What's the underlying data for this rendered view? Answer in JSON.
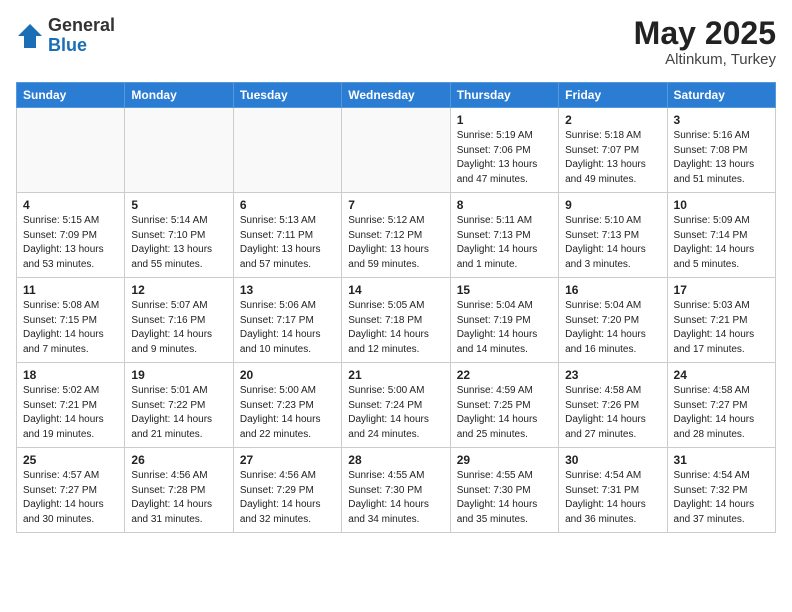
{
  "header": {
    "logo_general": "General",
    "logo_blue": "Blue",
    "title": "May 2025",
    "subtitle": "Altinkum, Turkey"
  },
  "weekdays": [
    "Sunday",
    "Monday",
    "Tuesday",
    "Wednesday",
    "Thursday",
    "Friday",
    "Saturday"
  ],
  "weeks": [
    [
      {
        "day": "",
        "info": ""
      },
      {
        "day": "",
        "info": ""
      },
      {
        "day": "",
        "info": ""
      },
      {
        "day": "",
        "info": ""
      },
      {
        "day": "1",
        "info": "Sunrise: 5:19 AM\nSunset: 7:06 PM\nDaylight: 13 hours\nand 47 minutes."
      },
      {
        "day": "2",
        "info": "Sunrise: 5:18 AM\nSunset: 7:07 PM\nDaylight: 13 hours\nand 49 minutes."
      },
      {
        "day": "3",
        "info": "Sunrise: 5:16 AM\nSunset: 7:08 PM\nDaylight: 13 hours\nand 51 minutes."
      }
    ],
    [
      {
        "day": "4",
        "info": "Sunrise: 5:15 AM\nSunset: 7:09 PM\nDaylight: 13 hours\nand 53 minutes."
      },
      {
        "day": "5",
        "info": "Sunrise: 5:14 AM\nSunset: 7:10 PM\nDaylight: 13 hours\nand 55 minutes."
      },
      {
        "day": "6",
        "info": "Sunrise: 5:13 AM\nSunset: 7:11 PM\nDaylight: 13 hours\nand 57 minutes."
      },
      {
        "day": "7",
        "info": "Sunrise: 5:12 AM\nSunset: 7:12 PM\nDaylight: 13 hours\nand 59 minutes."
      },
      {
        "day": "8",
        "info": "Sunrise: 5:11 AM\nSunset: 7:13 PM\nDaylight: 14 hours\nand 1 minute."
      },
      {
        "day": "9",
        "info": "Sunrise: 5:10 AM\nSunset: 7:13 PM\nDaylight: 14 hours\nand 3 minutes."
      },
      {
        "day": "10",
        "info": "Sunrise: 5:09 AM\nSunset: 7:14 PM\nDaylight: 14 hours\nand 5 minutes."
      }
    ],
    [
      {
        "day": "11",
        "info": "Sunrise: 5:08 AM\nSunset: 7:15 PM\nDaylight: 14 hours\nand 7 minutes."
      },
      {
        "day": "12",
        "info": "Sunrise: 5:07 AM\nSunset: 7:16 PM\nDaylight: 14 hours\nand 9 minutes."
      },
      {
        "day": "13",
        "info": "Sunrise: 5:06 AM\nSunset: 7:17 PM\nDaylight: 14 hours\nand 10 minutes."
      },
      {
        "day": "14",
        "info": "Sunrise: 5:05 AM\nSunset: 7:18 PM\nDaylight: 14 hours\nand 12 minutes."
      },
      {
        "day": "15",
        "info": "Sunrise: 5:04 AM\nSunset: 7:19 PM\nDaylight: 14 hours\nand 14 minutes."
      },
      {
        "day": "16",
        "info": "Sunrise: 5:04 AM\nSunset: 7:20 PM\nDaylight: 14 hours\nand 16 minutes."
      },
      {
        "day": "17",
        "info": "Sunrise: 5:03 AM\nSunset: 7:21 PM\nDaylight: 14 hours\nand 17 minutes."
      }
    ],
    [
      {
        "day": "18",
        "info": "Sunrise: 5:02 AM\nSunset: 7:21 PM\nDaylight: 14 hours\nand 19 minutes."
      },
      {
        "day": "19",
        "info": "Sunrise: 5:01 AM\nSunset: 7:22 PM\nDaylight: 14 hours\nand 21 minutes."
      },
      {
        "day": "20",
        "info": "Sunrise: 5:00 AM\nSunset: 7:23 PM\nDaylight: 14 hours\nand 22 minutes."
      },
      {
        "day": "21",
        "info": "Sunrise: 5:00 AM\nSunset: 7:24 PM\nDaylight: 14 hours\nand 24 minutes."
      },
      {
        "day": "22",
        "info": "Sunrise: 4:59 AM\nSunset: 7:25 PM\nDaylight: 14 hours\nand 25 minutes."
      },
      {
        "day": "23",
        "info": "Sunrise: 4:58 AM\nSunset: 7:26 PM\nDaylight: 14 hours\nand 27 minutes."
      },
      {
        "day": "24",
        "info": "Sunrise: 4:58 AM\nSunset: 7:27 PM\nDaylight: 14 hours\nand 28 minutes."
      }
    ],
    [
      {
        "day": "25",
        "info": "Sunrise: 4:57 AM\nSunset: 7:27 PM\nDaylight: 14 hours\nand 30 minutes."
      },
      {
        "day": "26",
        "info": "Sunrise: 4:56 AM\nSunset: 7:28 PM\nDaylight: 14 hours\nand 31 minutes."
      },
      {
        "day": "27",
        "info": "Sunrise: 4:56 AM\nSunset: 7:29 PM\nDaylight: 14 hours\nand 32 minutes."
      },
      {
        "day": "28",
        "info": "Sunrise: 4:55 AM\nSunset: 7:30 PM\nDaylight: 14 hours\nand 34 minutes."
      },
      {
        "day": "29",
        "info": "Sunrise: 4:55 AM\nSunset: 7:30 PM\nDaylight: 14 hours\nand 35 minutes."
      },
      {
        "day": "30",
        "info": "Sunrise: 4:54 AM\nSunset: 7:31 PM\nDaylight: 14 hours\nand 36 minutes."
      },
      {
        "day": "31",
        "info": "Sunrise: 4:54 AM\nSunset: 7:32 PM\nDaylight: 14 hours\nand 37 minutes."
      }
    ]
  ]
}
